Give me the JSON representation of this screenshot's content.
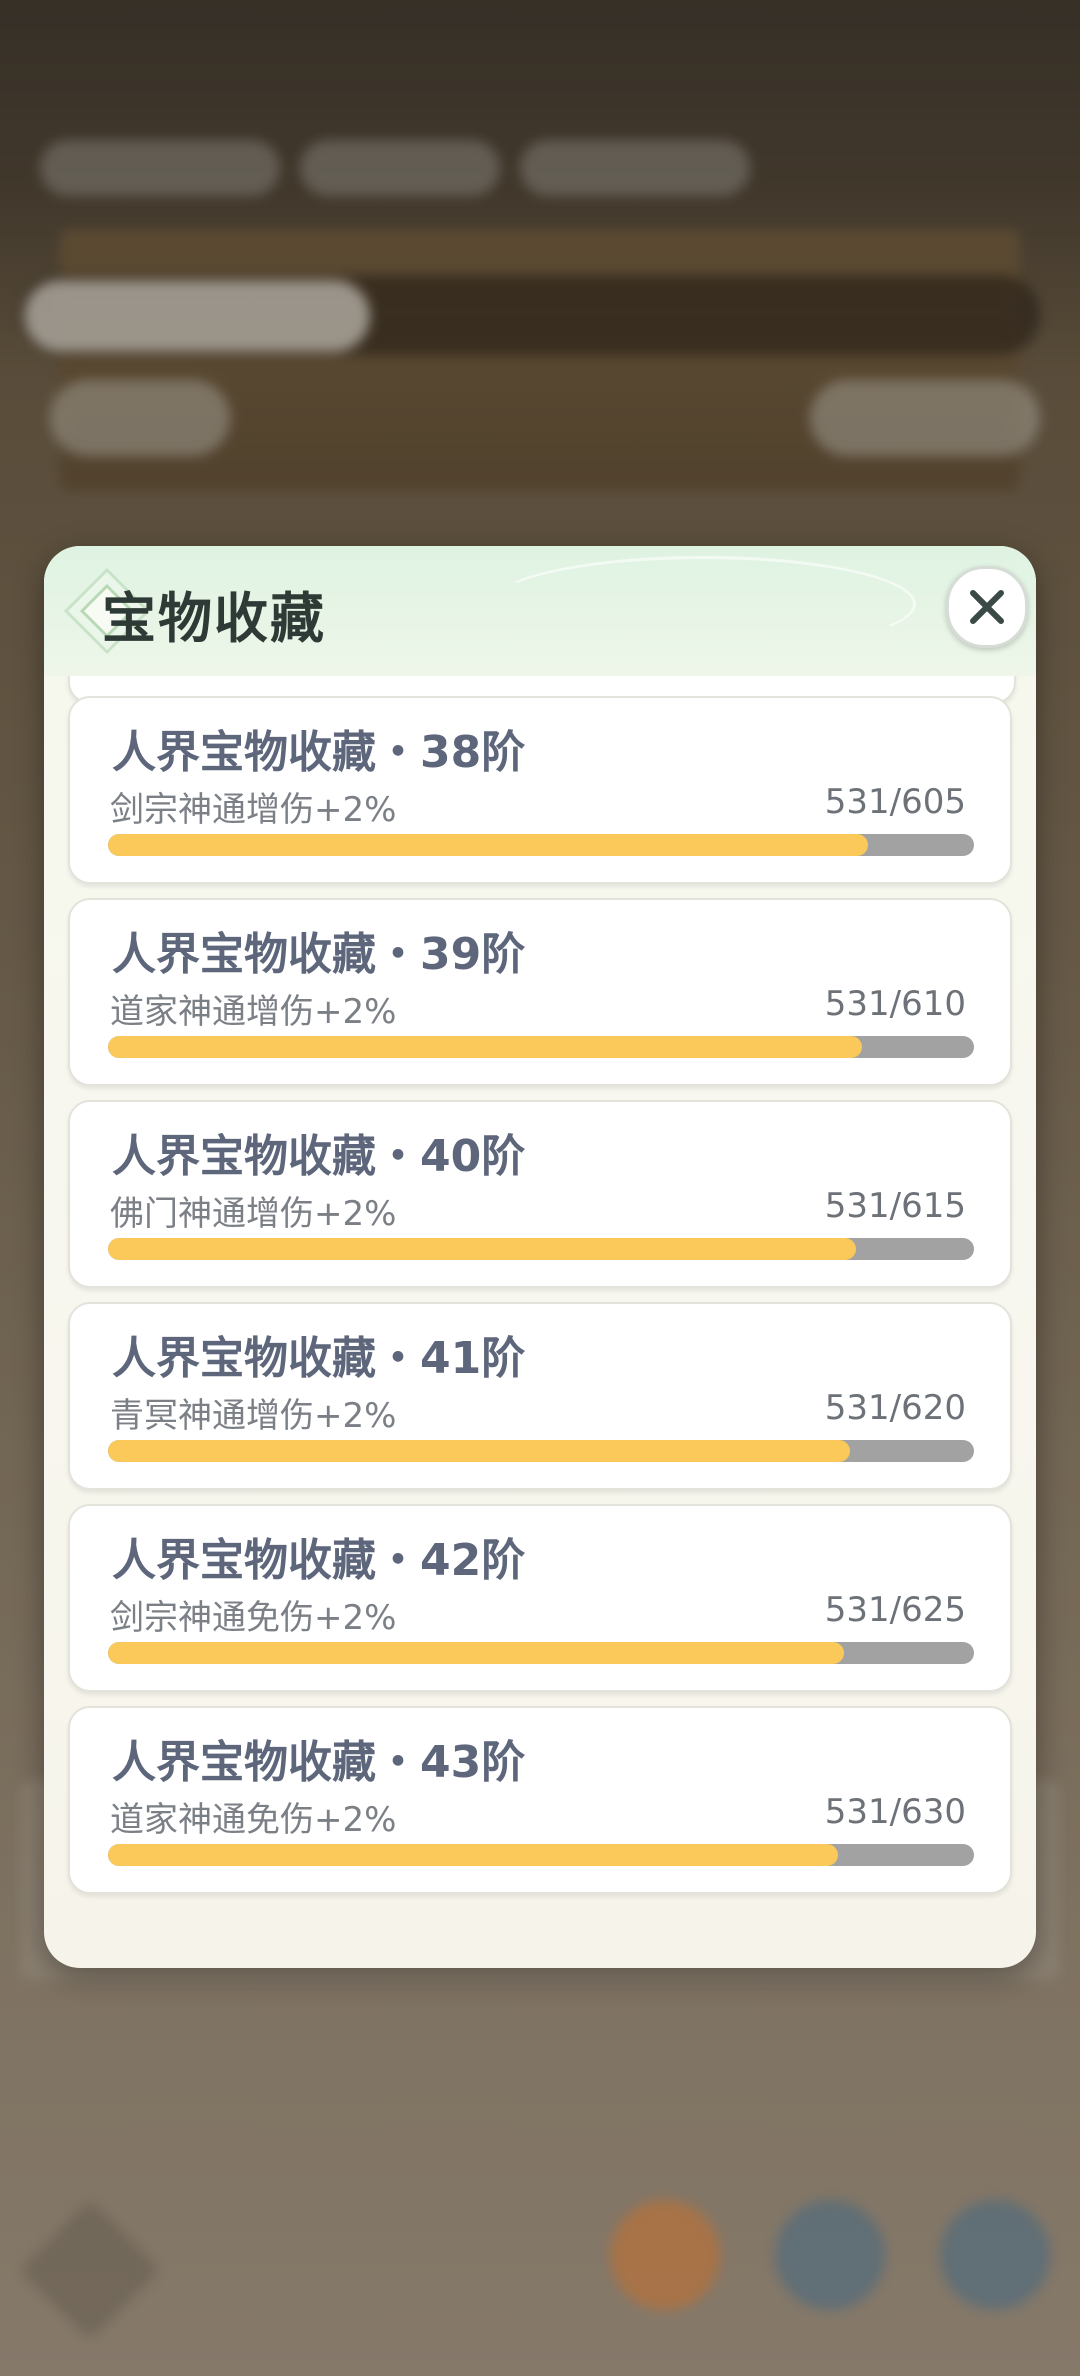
{
  "modal": {
    "title": "宝物收藏",
    "close_icon": "close-icon",
    "ornament_icon": "diamond-ornament-icon"
  },
  "colors": {
    "progress_fill": "#fbc85a",
    "progress_track": "#a2a2a2",
    "card_title": "#5d667a"
  },
  "items": [
    {
      "title": "人界宝物收藏・38阶",
      "effect": "剑宗神通增伤+2%",
      "progress_text": "531/605",
      "current": 531,
      "total": 605
    },
    {
      "title": "人界宝物收藏・39阶",
      "effect": "道家神通增伤+2%",
      "progress_text": "531/610",
      "current": 531,
      "total": 610
    },
    {
      "title": "人界宝物收藏・40阶",
      "effect": "佛门神通增伤+2%",
      "progress_text": "531/615",
      "current": 531,
      "total": 615
    },
    {
      "title": "人界宝物收藏・41阶",
      "effect": "青冥神通增伤+2%",
      "progress_text": "531/620",
      "current": 531,
      "total": 620
    },
    {
      "title": "人界宝物收藏・42阶",
      "effect": "剑宗神通免伤+2%",
      "progress_text": "531/625",
      "current": 531,
      "total": 625
    },
    {
      "title": "人界宝物收藏・43阶",
      "effect": "道家神通免伤+2%",
      "progress_text": "531/630",
      "current": 531,
      "total": 630
    }
  ]
}
